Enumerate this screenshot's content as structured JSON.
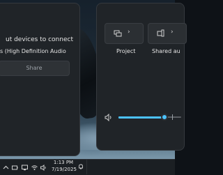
{
  "cast_panel": {
    "title": "ut devices to connect",
    "device": "s (High Definition Audio",
    "share_label": "Share"
  },
  "quick_settings": {
    "tiles": [
      {
        "label": "Project",
        "icon": "project-icon"
      },
      {
        "label": "Shared au",
        "icon": "nearby-share-icon"
      }
    ],
    "volume_percent": 73,
    "accent_color": "#4cc2ff"
  },
  "taskbar": {
    "time": "1:13 PM",
    "date": "7/19/2025",
    "tray_icons": [
      "chevron-up-icon",
      "battery-icon",
      "monitor-icon",
      "wifi-icon",
      "volume-icon"
    ]
  }
}
